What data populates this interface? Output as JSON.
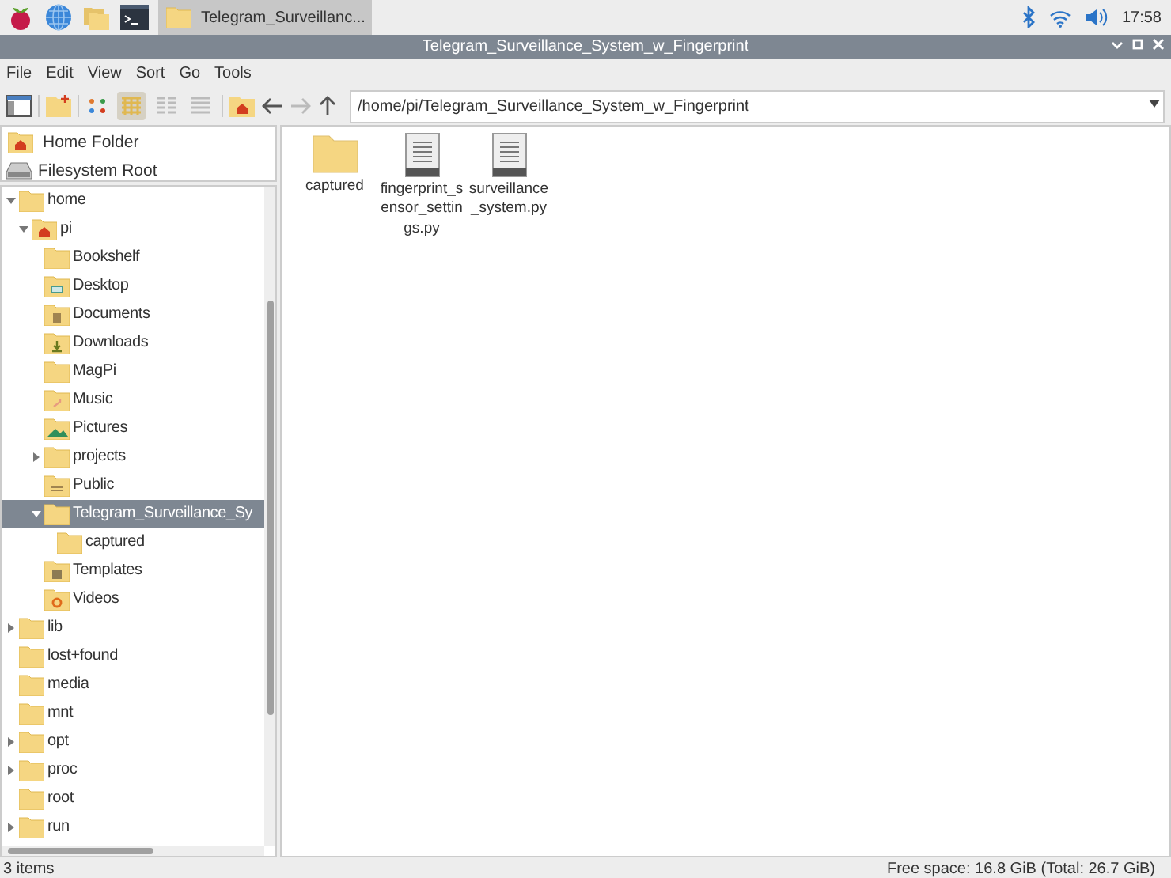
{
  "taskbar": {
    "window_button": "Telegram_Surveillanc...",
    "clock": "17:58"
  },
  "window": {
    "title": "Telegram_Surveillance_System_w_Fingerprint"
  },
  "menu": [
    "File",
    "Edit",
    "View",
    "Sort",
    "Go",
    "Tools"
  ],
  "toolbar": {
    "view_modes": [
      {
        "selected": true
      },
      {
        "selected": false
      },
      {
        "selected": false
      }
    ],
    "path": "/home/pi/Telegram_Surveillance_System_w_Fingerprint"
  },
  "places": [
    {
      "kind": "home",
      "label": "Home Folder"
    },
    {
      "kind": "drive",
      "label": "Filesystem Root"
    }
  ],
  "tree": [
    {
      "label": "home",
      "expanded": true,
      "selected": false,
      "children": [
        {
          "label": "pi",
          "kind": "home",
          "expanded": true,
          "selected": false,
          "children": [
            {
              "label": "Bookshelf",
              "selected": false
            },
            {
              "label": "Desktop",
              "kind": "desktop",
              "selected": false
            },
            {
              "label": "Documents",
              "kind": "documents",
              "selected": false
            },
            {
              "label": "Downloads",
              "kind": "downloads",
              "selected": false
            },
            {
              "label": "MagPi",
              "selected": false
            },
            {
              "label": "Music",
              "kind": "music",
              "selected": false
            },
            {
              "label": "Pictures",
              "kind": "pictures",
              "selected": false
            },
            {
              "label": "projects",
              "expanded": false,
              "selected": false
            },
            {
              "label": "Public",
              "kind": "public",
              "selected": false
            },
            {
              "label": "Telegram_Surveillance_Sy",
              "expanded": true,
              "selected": true,
              "children": [
                {
                  "label": "captured",
                  "selected": false
                }
              ]
            },
            {
              "label": "Templates",
              "kind": "templates",
              "selected": false
            },
            {
              "label": "Videos",
              "kind": "videos",
              "selected": false
            }
          ]
        }
      ]
    },
    {
      "label": "lib",
      "expanded": false,
      "selected": false
    },
    {
      "label": "lost+found",
      "selected": false
    },
    {
      "label": "media",
      "selected": false
    },
    {
      "label": "mnt",
      "selected": false
    },
    {
      "label": "opt",
      "expanded": false,
      "selected": false
    },
    {
      "label": "proc",
      "expanded": false,
      "selected": false
    },
    {
      "label": "root",
      "selected": false
    },
    {
      "label": "run",
      "expanded": false,
      "selected": false
    }
  ],
  "files": [
    {
      "kind": "folder",
      "name": "captured"
    },
    {
      "kind": "text",
      "name": "fingerprint_sensor_settings.py"
    },
    {
      "kind": "text",
      "name": "surveillance_system.py"
    }
  ],
  "status_bar": {
    "items": "3 items",
    "free_space": "Free space: 16.8 GiB (Total: 26.7 GiB)"
  }
}
